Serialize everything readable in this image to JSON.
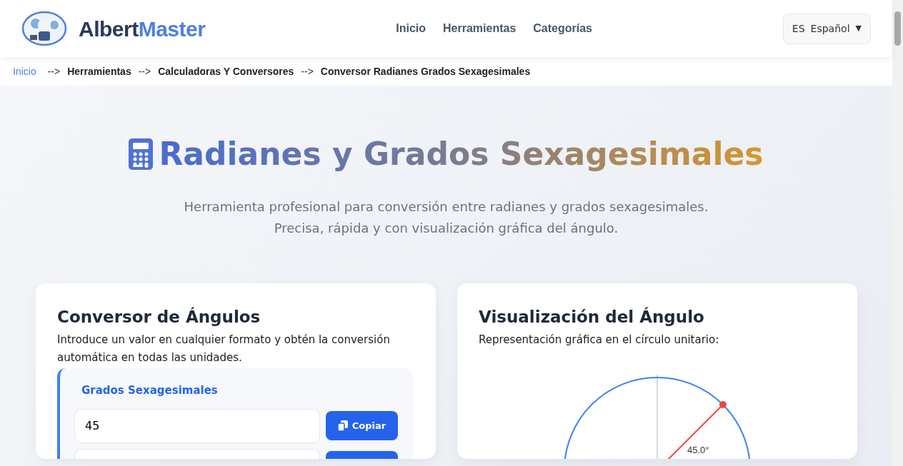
{
  "brand": {
    "first": "Albert",
    "second": "Master"
  },
  "nav": [
    {
      "label": "Inicio"
    },
    {
      "label": "Herramientas"
    },
    {
      "label": "Categorías"
    }
  ],
  "language": {
    "code": "ES",
    "label": "Español",
    "caret": "▼"
  },
  "breadcrumb": [
    {
      "label": "Inicio",
      "link": true
    },
    {
      "label": "Herramientas",
      "link": false
    },
    {
      "label": "Calculadoras Y Conversores",
      "link": false
    },
    {
      "label": "Conversor Radianes Grados Sexagesimales",
      "link": false
    }
  ],
  "breadcrumb_separator": "-->",
  "hero": {
    "title": "Radianes y Grados Sexagesimales",
    "subtitle_lines": [
      "Herramienta profesional para conversión entre radianes y grados sexagesimales.",
      "Precisa, rápida y con visualización gráfica del ángulo."
    ]
  },
  "converter": {
    "title": "Conversor de Ángulos",
    "description": "Introduce un valor en cualquier formato y obtén la conversión automática en todas las unidades.",
    "section_title": "Grados Sexagesimales",
    "rows": [
      {
        "value": "45",
        "button": "Copiar"
      },
      {
        "button": ""
      }
    ]
  },
  "visual": {
    "title": "Visualización del Ángulo",
    "description": "Representación gráfica en el círculo unitario:",
    "angle_label": "45.0°"
  }
}
